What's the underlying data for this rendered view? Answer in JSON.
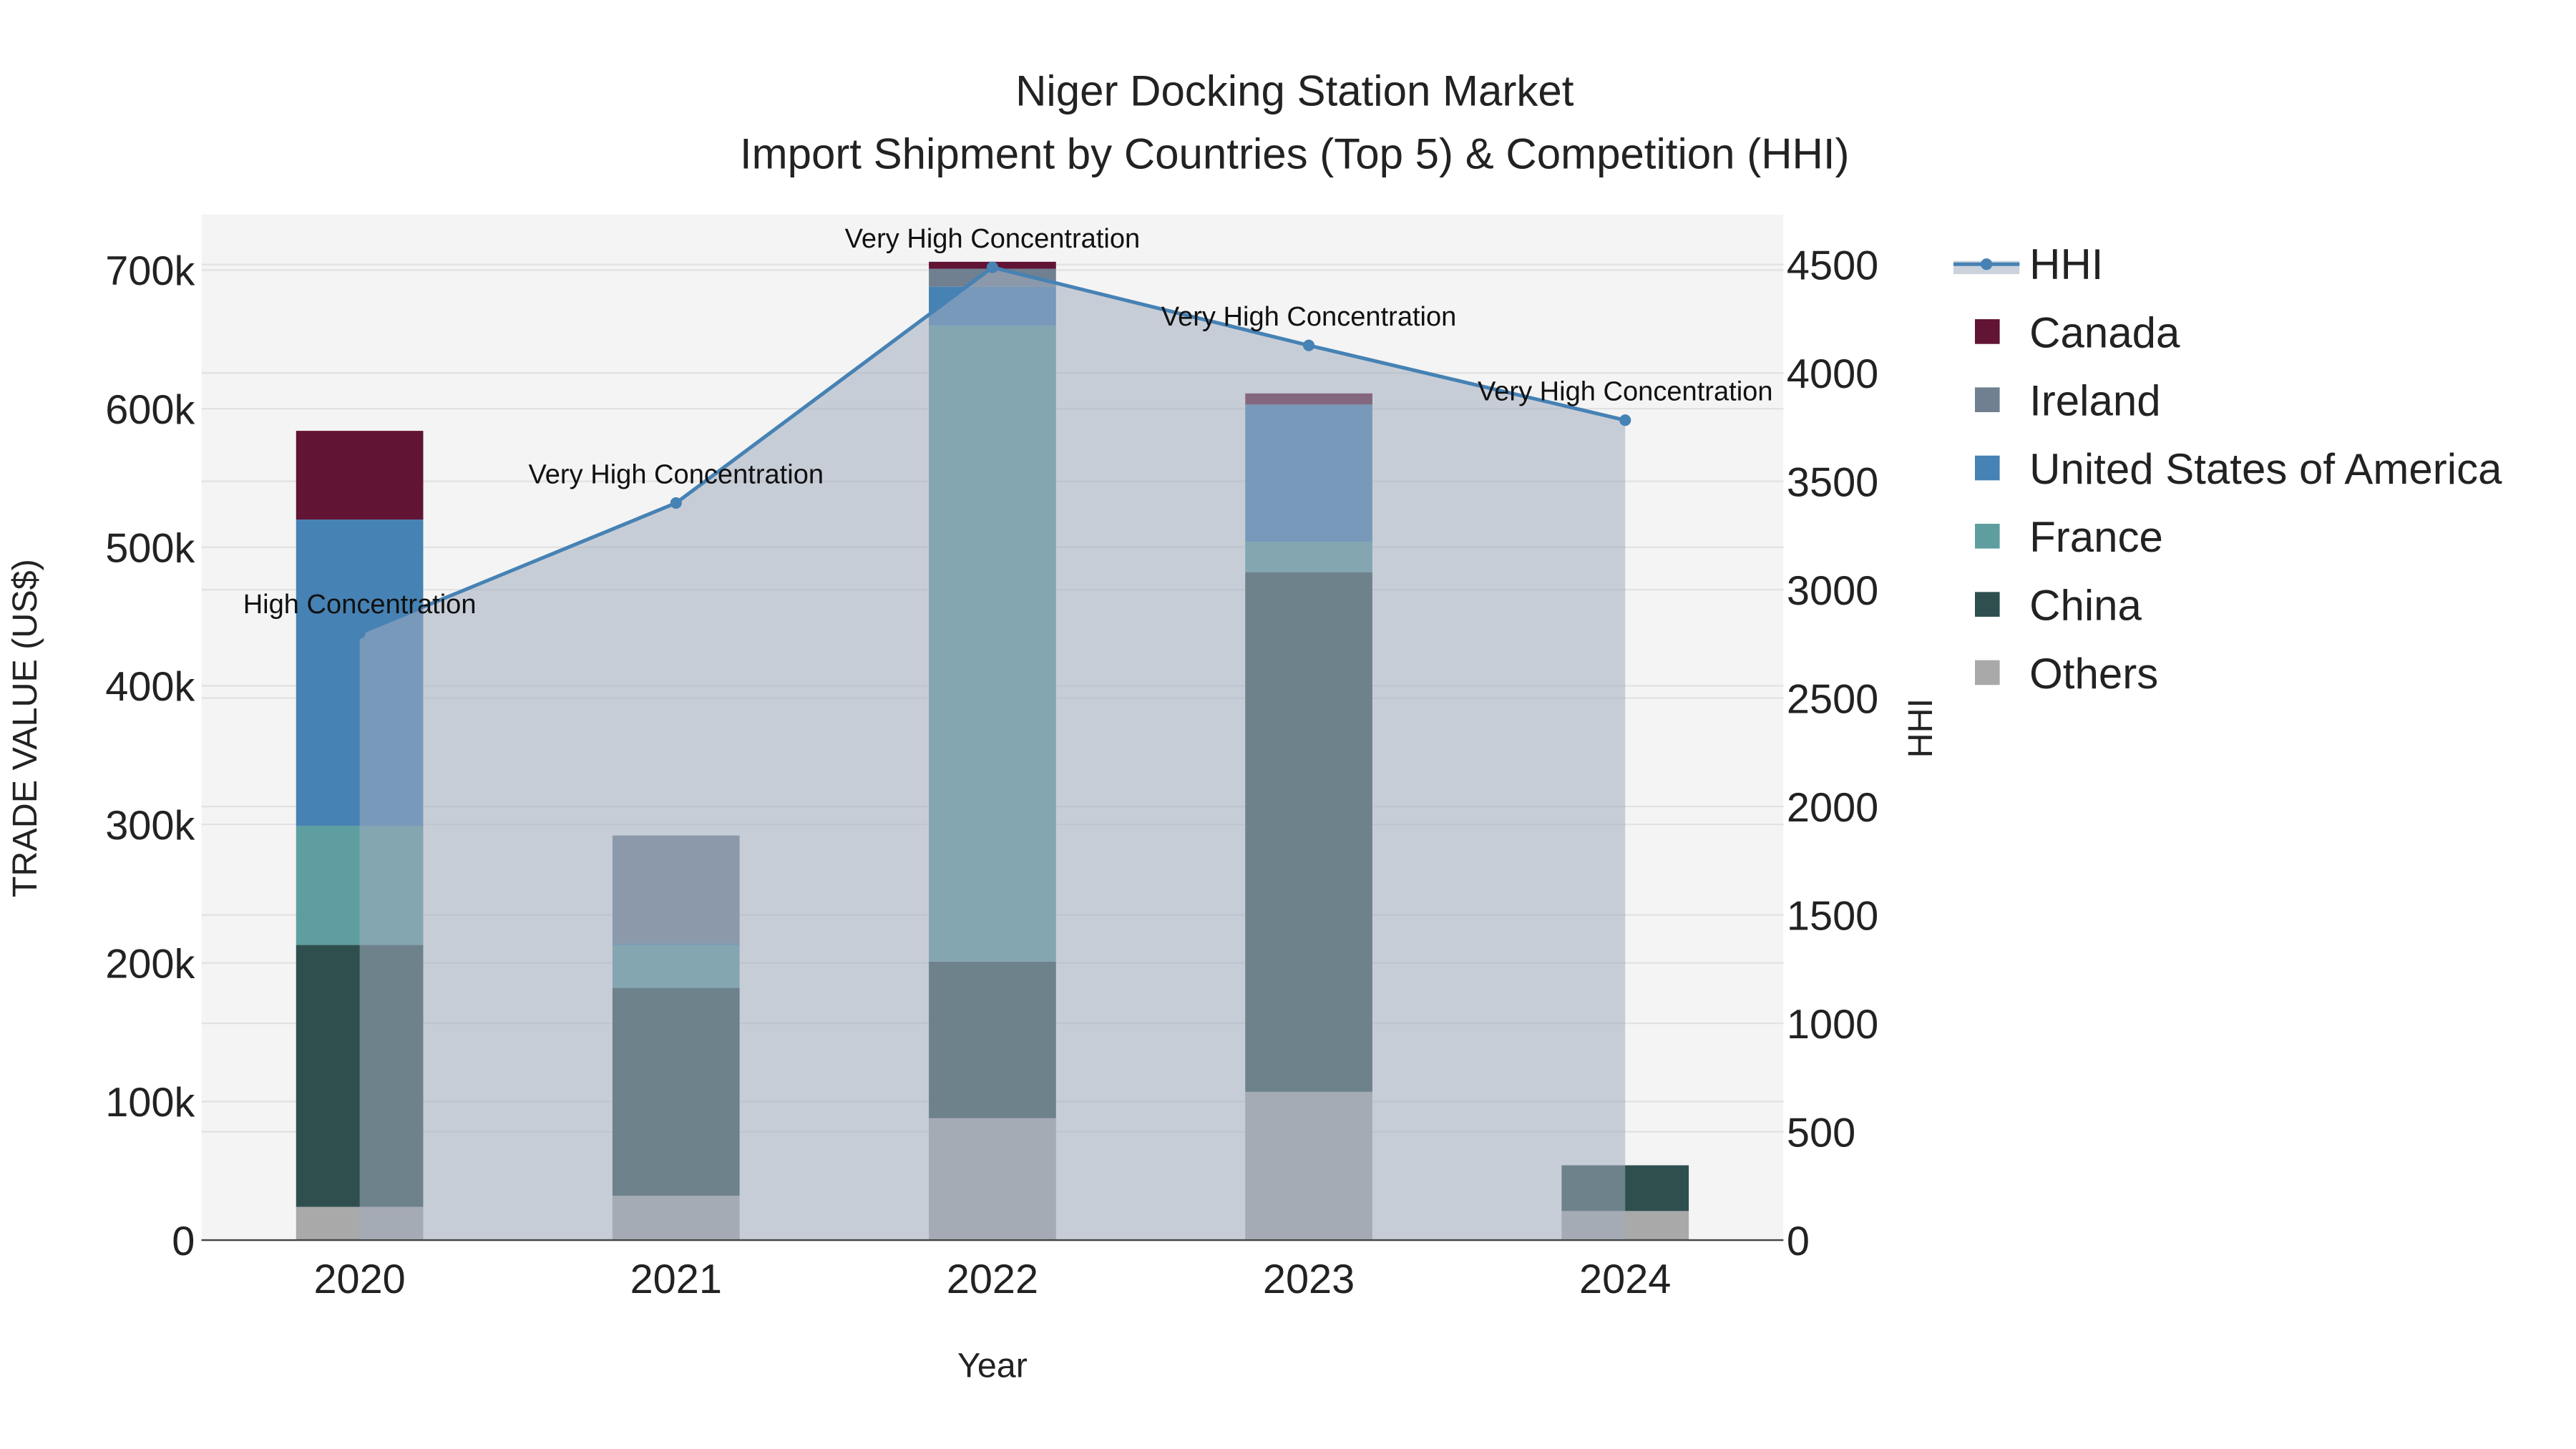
{
  "chart_data": {
    "type": "bar",
    "title": "Niger Docking Station Market",
    "subtitle": "Import Shipment by Countries (Top 5) & Competition (HHI)",
    "xlabel": "Year",
    "ylabel": "TRADE VALUE (US$)",
    "y2label": "HHI",
    "categories": [
      "2020",
      "2021",
      "2022",
      "2023",
      "2024"
    ],
    "ylim": [
      0,
      740000
    ],
    "y2lim": [
      0,
      4730
    ],
    "yticks": [
      0,
      100000,
      200000,
      300000,
      400000,
      500000,
      600000,
      700000
    ],
    "ytick_labels": [
      "0",
      "100k",
      "200k",
      "300k",
      "400k",
      "500k",
      "600k",
      "700k"
    ],
    "y2ticks": [
      0,
      500,
      1000,
      1500,
      2000,
      2500,
      3000,
      3500,
      4000,
      4500
    ],
    "y2tick_labels": [
      "0",
      "500",
      "1000",
      "1500",
      "2000",
      "2500",
      "3000",
      "3500",
      "4000",
      "4500"
    ],
    "stacked": true,
    "series": [
      {
        "name": "Others",
        "color": "#A9A9A9",
        "values": [
          24000,
          32000,
          88000,
          107000,
          21000
        ]
      },
      {
        "name": "China",
        "color": "#2F4F4F",
        "values": [
          189000,
          150000,
          113000,
          375000,
          33000
        ]
      },
      {
        "name": "France",
        "color": "#5F9EA0",
        "values": [
          86000,
          31000,
          459000,
          22000,
          0
        ]
      },
      {
        "name": "United States of America",
        "color": "#4682B4",
        "values": [
          221000,
          1000,
          28000,
          99000,
          0
        ]
      },
      {
        "name": "Ireland",
        "color": "#708090",
        "values": [
          0,
          78000,
          13000,
          0,
          0
        ]
      },
      {
        "name": "Canada",
        "color": "#611434",
        "values": [
          64000,
          0,
          5000,
          8000,
          0
        ]
      }
    ],
    "hhi": {
      "name": "HHI",
      "color": "#4682B4",
      "values": [
        2800,
        3400,
        4487,
        4127,
        3782
      ],
      "annotations": [
        "High Concentration",
        "Very High Concentration",
        "Very High Concentration",
        "Very High Concentration",
        "Very High Concentration"
      ]
    },
    "legend": {
      "placement": "right",
      "order": [
        "HHI",
        "Canada",
        "Ireland",
        "United States of America",
        "France",
        "China",
        "Others"
      ]
    },
    "grid": true
  }
}
